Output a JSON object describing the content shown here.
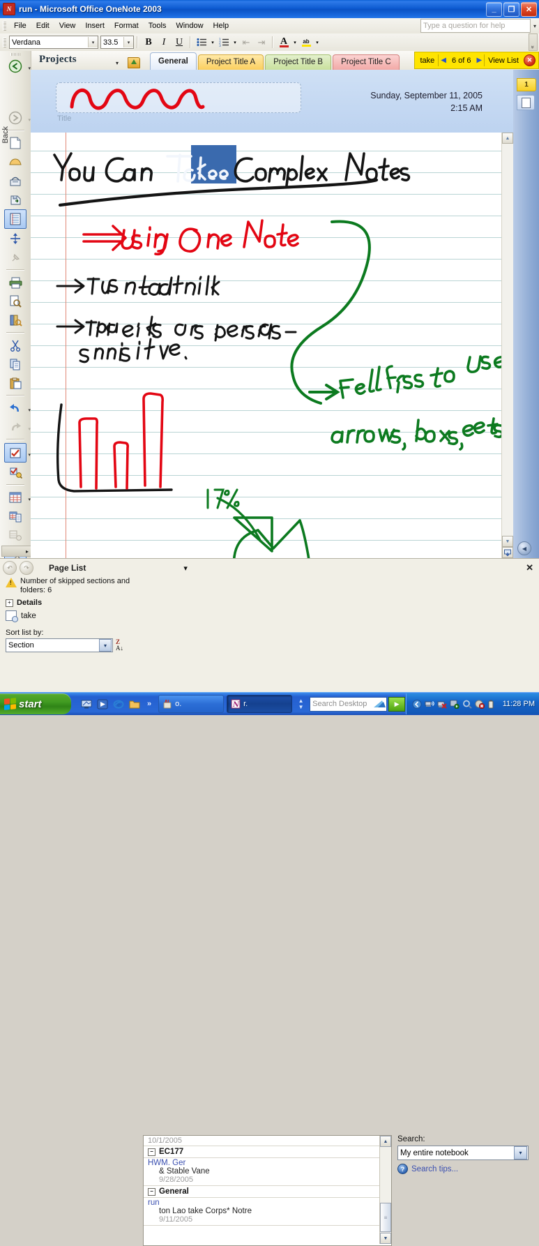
{
  "window": {
    "title": "run - Microsoft Office OneNote 2003",
    "app_icon": "onenote-icon",
    "minimize_glyph": "_",
    "restore_glyph": "❐",
    "close_glyph": "✕"
  },
  "menu": {
    "items": [
      "File",
      "Edit",
      "View",
      "Insert",
      "Format",
      "Tools",
      "Window",
      "Help"
    ],
    "help_placeholder": "Type a question for help",
    "help_arrow": "▾"
  },
  "format_toolbar": {
    "font_name": "Verdana",
    "font_size": "33.5",
    "bold": "B",
    "italic": "I",
    "underline": "U",
    "bullets": "≡",
    "numbering": "≡",
    "decrease_indent": "⇤",
    "increase_indent": "⇥",
    "font_color": "A",
    "highlight": "ab",
    "dropdown_arrow": "▾",
    "overflow": "»"
  },
  "section_bar": {
    "notebook_label": "Projects",
    "dropdown_arrow": "▾",
    "tabs": [
      {
        "label": "General",
        "active": true
      },
      {
        "label": "Project Title A",
        "active": false
      },
      {
        "label": "Project Title B",
        "active": false
      },
      {
        "label": "Project Title C",
        "active": false
      }
    ]
  },
  "find_bar": {
    "query": "take",
    "prev_arrow": "◀",
    "counter": "6 of 6",
    "next_arrow": "▶",
    "view_list": "View List",
    "close": "✕"
  },
  "left_toolbar": {
    "back_label": "Back",
    "back_arrow": "↶",
    "forward_arrow": "↷",
    "items": [
      "new-page-icon",
      "new-subpage-icon",
      "open-icon",
      "save-as-icon",
      "page-setup-icon",
      "adjust-page-size-icon",
      "pin-icon",
      "print-icon",
      "print-preview-icon",
      "research-icon",
      "cut-icon",
      "copy-icon",
      "paste-icon",
      "undo-icon",
      "redo-icon",
      "note-flag-icon",
      "note-flag-summary-icon",
      "insert-table-icon",
      "insert-outlook-task-icon",
      "insert-file-printout-icon",
      "pen-icon",
      "highlighter-icon",
      "text-select-icon",
      "eraser-icon",
      "audio-recording-icon"
    ],
    "expand": "▸"
  },
  "page": {
    "title_placeholder": "Title",
    "title_ink": "red-squiggle-ink",
    "date": "Sunday, September 11, 2005",
    "time": "2:15 AM",
    "page_number": "1",
    "new_page_icon": "new-page-icon",
    "collapse_icon": "◀",
    "ink": {
      "heading": "You Can Take Complex Notes",
      "red_note": "⇒ Using One Note",
      "bullet_1": "→ This is the default ink",
      "bullet_2": "→ Tablet PCs use pressure-sensitive.",
      "green_note": "→ Feel free to use arrows, boxes, etc.",
      "chart_label": "17%",
      "selection_highlight": "Take"
    }
  },
  "page_list": {
    "nav_back": "↶",
    "nav_forward": "↷",
    "title": "Page List",
    "dropdown_arrow": "▾",
    "close": "✕",
    "warning": "Number of skipped sections and folders: 6",
    "details_label": "Details",
    "details_expander": "+",
    "search_term": "take",
    "sort_label": "Sort list by:",
    "sort_value": "Section",
    "sort_dropdown": "▾",
    "sort_direction_icon": "sort-z-to-a-icon",
    "results": [
      {
        "kind": "date",
        "text": "10/1/2005"
      },
      {
        "kind": "section",
        "text": "EC177",
        "expander": "−"
      },
      {
        "kind": "page",
        "title": "HWM. Ger",
        "snippet": "& Stable Vane",
        "date": "9/28/2005"
      },
      {
        "kind": "section",
        "text": "General",
        "expander": "−"
      },
      {
        "kind": "page",
        "title": "run",
        "snippet": "ton Lao take Corps* Notre",
        "date": "9/11/2005"
      }
    ],
    "scroll_up": "▲",
    "scroll_down": "▼",
    "scroll_thumb": "≡"
  },
  "search_pane": {
    "label": "Search:",
    "scope_value": "My entire notebook",
    "scope_dropdown": "▾",
    "tips_label": "Search tips...",
    "tips_icon": "help-icon"
  },
  "taskbar": {
    "start_label": "start",
    "quick_launch": [
      "show-desktop-icon",
      "media-icon",
      "internet-explorer-icon",
      "folder-icon"
    ],
    "quick_launch_chevron": "»",
    "tasks": [
      {
        "label": "o.",
        "icon": "paint-icon",
        "active": false
      },
      {
        "label": "r.",
        "icon": "onenote-icon",
        "active": true
      }
    ],
    "spin_up": "▲",
    "spin_down": "▼",
    "desktop_search_placeholder": "Search Desktop",
    "desktop_search_go": "▶",
    "tray_icons": [
      "hide-icons-icon",
      "network-icon",
      "network-error-icon",
      "display-icon",
      "magnifier-icon",
      "security-icon",
      "battery-icon"
    ],
    "clock": "11:28 PM"
  },
  "colors": {
    "accent_blue": "#0a52c4",
    "find_bar_yellow": "#ffe400",
    "selection_blue": "#3a6aae",
    "ink_black": "#141414",
    "ink_red": "#e30613",
    "ink_green": "#0c7a1f",
    "ruled_line": "#b9d4d4",
    "margin_red": "#e08878",
    "link_blue": "#3a4fb0",
    "start_green": "#419b22"
  }
}
